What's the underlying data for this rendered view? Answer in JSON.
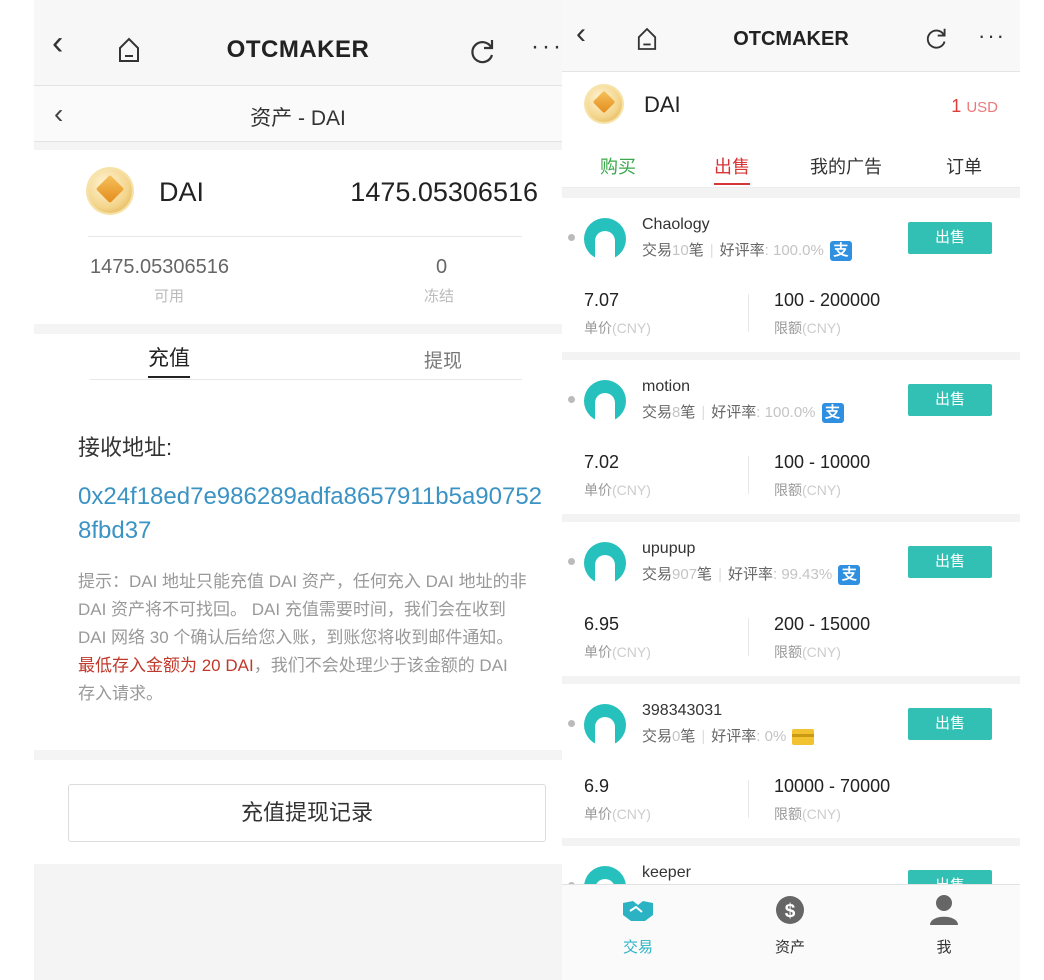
{
  "left": {
    "nav": {
      "title": "OTCMAKER",
      "more": "···"
    },
    "subheader": {
      "title": "资产 - DAI"
    },
    "asset": {
      "name": "DAI",
      "balance": "1475.05306516",
      "available_value": "1475.05306516",
      "available_label": "可用",
      "frozen_value": "0",
      "frozen_label": "冻结"
    },
    "tabs": {
      "deposit": "充值",
      "withdraw": "提现"
    },
    "address_label": "接收地址:",
    "address": "0x24f18ed7e986289adfa8657911b5a907528fbd37",
    "hint": {
      "part1": "提示：DAI 地址只能充值 DAI 资产，任何充入 DAI 地址的非 DAI 资产将不可找回。 DAI 充值需要时间，我们会在收到 DAI 网络 30 个确认后给您入账，到账您将收到邮件通知。",
      "red": "最低存入金额为 20 DAI",
      "part2": "，我们不会处理少于该金额的 DAI 存入请求。"
    },
    "records_button": "充值提现记录"
  },
  "right": {
    "nav": {
      "title": "OTCMAKER",
      "more": "···"
    },
    "coin": {
      "name": "DAI",
      "price": "1",
      "unit": "USD"
    },
    "tabs": {
      "buy": "购买",
      "sell": "出售",
      "my_ads": "我的广告",
      "orders": "订单"
    },
    "ads": [
      {
        "user": "Chaology",
        "trade_prefix": "交易",
        "trade_count": "10",
        "trade_suffix": "笔",
        "rating_label": "好评率",
        "rating": "100.0%",
        "payment": "alipay",
        "action": "出售",
        "price": "7.07",
        "price_label": "单价",
        "price_unit": "(CNY)",
        "limit": "100 - 200000",
        "limit_label": "限额",
        "limit_unit": "(CNY)"
      },
      {
        "user": "motion",
        "trade_prefix": "交易",
        "trade_count": "8",
        "trade_suffix": "笔",
        "rating_label": "好评率",
        "rating": "100.0%",
        "payment": "alipay",
        "action": "出售",
        "price": "7.02",
        "price_label": "单价",
        "price_unit": "(CNY)",
        "limit": "100 - 10000",
        "limit_label": "限额",
        "limit_unit": "(CNY)"
      },
      {
        "user": "upupup",
        "trade_prefix": "交易",
        "trade_count": "907",
        "trade_suffix": "笔",
        "rating_label": "好评率",
        "rating": "99.43%",
        "payment": "alipay",
        "action": "出售",
        "price": "6.95",
        "price_label": "单价",
        "price_unit": "(CNY)",
        "limit": "200 - 15000",
        "limit_label": "限额",
        "limit_unit": "(CNY)"
      },
      {
        "user": "398343031",
        "trade_prefix": "交易",
        "trade_count": "0",
        "trade_suffix": "笔",
        "rating_label": "好评率",
        "rating": "0%",
        "payment": "bank-card",
        "action": "出售",
        "price": "6.9",
        "price_label": "单价",
        "price_unit": "(CNY)",
        "limit": "10000 - 70000",
        "limit_label": "限额",
        "limit_unit": "(CNY)"
      },
      {
        "user": "keeper",
        "action": "出售"
      }
    ],
    "bottom_nav": {
      "trade": "交易",
      "asset": "资产",
      "me": "我"
    }
  },
  "colors": {
    "accent_teal": "#31c0b3",
    "sell_red": "#d63636",
    "buy_green": "#3aa84a",
    "address_blue": "#3b93c4"
  }
}
